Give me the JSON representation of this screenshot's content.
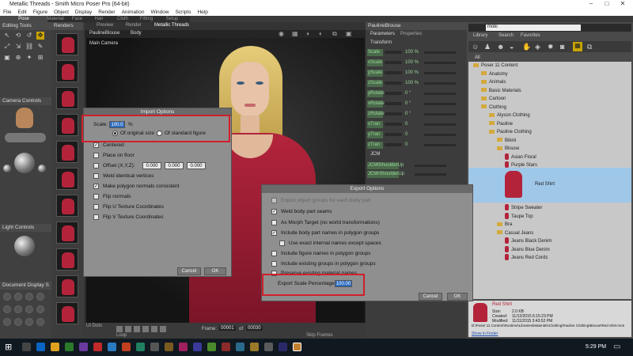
{
  "app": {
    "title": "Metallic Threads - Smith Micro Poser Pro (64-bit)",
    "menu": [
      "File",
      "Edit",
      "Figure",
      "Object",
      "Display",
      "Render",
      "Animation",
      "Window",
      "Scripts",
      "Help"
    ]
  },
  "rooms": [
    "Pose",
    "Material",
    "Face",
    "Hair",
    "Cloth",
    "Fitting",
    "Setup"
  ],
  "left_panel": {
    "editing_tools_title": "Editing Tools",
    "camera_controls_title": "Camera Controls",
    "light_controls_title": "Light Controls",
    "document_display_title": "Document Display S"
  },
  "renders_title": "Renders",
  "viewport": {
    "tabs": [
      "Preview",
      "Render",
      "Metallic Threads"
    ],
    "figure_select": "PaulineBlouse",
    "part_select": "Body",
    "camera_label": "Main Camera",
    "ui_dots_label": "UI Dots",
    "loop_label": "Loop",
    "skip_frames_label": "Skip Frames",
    "frame_label": "Frame:",
    "frame_current": "00001",
    "frame_of": "of",
    "frame_total": "00030"
  },
  "parameters": {
    "figure_select": "PaulineBlouse",
    "tabs": [
      "Parameters",
      "Properties"
    ],
    "group_transform": "Transform",
    "rows": [
      {
        "label": "Scale",
        "value": "100 %"
      },
      {
        "label": "xScale",
        "value": "100 %"
      },
      {
        "label": "yScale",
        "value": "100 %"
      },
      {
        "label": "zScale",
        "value": "100 %"
      },
      {
        "label": "yRotate",
        "value": "0 °"
      },
      {
        "label": "xRotate",
        "value": "0 °"
      },
      {
        "label": "zRotate",
        "value": "0 °"
      },
      {
        "label": "xTran",
        "value": "0"
      },
      {
        "label": "yTran",
        "value": "0"
      },
      {
        "label": "zTran",
        "value": "0"
      }
    ],
    "group_jcm": "JCM",
    "jcm_rows": [
      "JCMlShoulderUp",
      "JCMrShoulderUp"
    ]
  },
  "library": {
    "search_value": "moki",
    "tabs": [
      "Library",
      "Search",
      "Favorites"
    ],
    "all_label": "All",
    "tree": [
      {
        "label": "Poser 11 Content",
        "level": 0,
        "kind": "folder"
      },
      {
        "label": "Anatomy",
        "level": 1,
        "kind": "folder"
      },
      {
        "label": "Animals",
        "level": 1,
        "kind": "folder"
      },
      {
        "label": "Basic Materials",
        "level": 1,
        "kind": "folder"
      },
      {
        "label": "Cartoon",
        "level": 1,
        "kind": "folder"
      },
      {
        "label": "Clothing",
        "level": 1,
        "kind": "folder"
      },
      {
        "label": "Alyson Clothing",
        "level": 2,
        "kind": "folder"
      },
      {
        "label": "Pauline",
        "level": 2,
        "kind": "folder"
      },
      {
        "label": "Pauline Clothing",
        "level": 2,
        "kind": "folder"
      },
      {
        "label": "Bikini",
        "level": 3,
        "kind": "folder"
      },
      {
        "label": "Blouse",
        "level": 3,
        "kind": "folder"
      },
      {
        "label": "Asian Floral",
        "level": 4,
        "kind": "item"
      },
      {
        "label": "Purple Stars",
        "level": 4,
        "kind": "item"
      }
    ],
    "selected_item": "Red Shirt",
    "tree_after": [
      {
        "label": "Stripe Sweater",
        "level": 4,
        "kind": "item"
      },
      {
        "label": "Taupe Top",
        "level": 4,
        "kind": "item"
      },
      {
        "label": "Bra",
        "level": 3,
        "kind": "folder"
      },
      {
        "label": "Casual Jeans",
        "level": 3,
        "kind": "folder"
      },
      {
        "label": "Jeans Black Denim",
        "level": 4,
        "kind": "item"
      },
      {
        "label": "Jeans Blue Denim",
        "level": 4,
        "kind": "item"
      },
      {
        "label": "Jeans Red Cords",
        "level": 4,
        "kind": "item"
      }
    ],
    "info": {
      "name": "Red Shirt",
      "size_label": "Size:",
      "size": "2.0 KB",
      "created_label": "Created:",
      "created": "11/12/2015 6:15:23 PM",
      "modified_label": "Modified:",
      "modified": "11/11/2015 3:43:52 PM",
      "path": "D:\\Poser 11 Content\\Runtime\\Libraries\\Materials\\Clothing\\Pauline Clothing\\Blouse\\Red Shirt.mc6",
      "show_in_finder": "Show in Finder"
    }
  },
  "import_dialog": {
    "title": "Import Options",
    "scale_label": "Scale:",
    "scale_value": "100.0",
    "scale_unit": "%",
    "radio_original": "Of original size",
    "radio_standard": "Of standard figure",
    "centered": "Centered",
    "place_on_floor": "Place on floor",
    "offset_label": "Offset (X,Y,Z):",
    "offset_x": "0.000",
    "offset_y": "0.000",
    "offset_z": "0.000",
    "weld": "Weld identical vertices",
    "make_normals": "Make polygon normals consistent",
    "flip_normals": "Flip normals",
    "flip_u": "Flip U Texture Coordinates",
    "flip_v": "Flip V Texture Coordinates",
    "cancel": "Cancel",
    "ok": "OK"
  },
  "export_dialog": {
    "title": "Export Options",
    "opt_export_groups": "Export object groups for each body part",
    "opt_weld": "Weld body part seams",
    "opt_morph": "As Morph Target (no world transformations)",
    "opt_include_body": "Include body part names in polygon groups",
    "opt_exact_names": "Use exact internal names except spaces",
    "opt_figure_names": "Include figure names in polygon groups",
    "opt_existing_groups": "Include existing groups in polygon groups",
    "opt_preserve": "Preserve existing material names",
    "scale_label": "Export Scale Percentage:",
    "scale_value": "100.00",
    "cancel": "Cancel",
    "ok": "OK"
  },
  "taskbar": {
    "time": "5:29 PM"
  },
  "colors": {
    "highlight_box": "#d0202a",
    "selection": "#9fc7e8",
    "param_label": "#9ad49a",
    "garment": "#b3243b"
  }
}
